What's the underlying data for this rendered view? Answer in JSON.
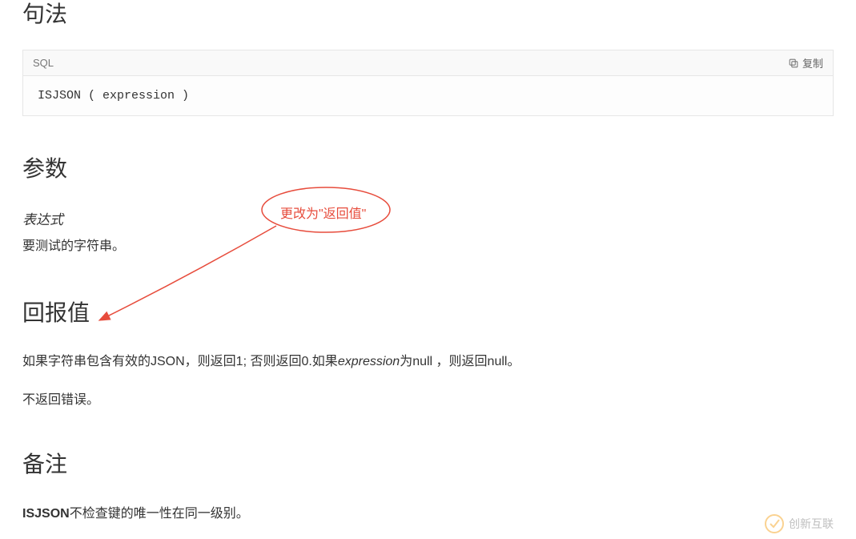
{
  "headings": {
    "syntax": "句法",
    "params": "参数",
    "return": "回报值",
    "remarks": "备注"
  },
  "code": {
    "lang_label": "SQL",
    "copy_label": "复制",
    "body": "ISJSON ( expression )"
  },
  "params": {
    "name": "表达式",
    "desc": "要测试的字符串。"
  },
  "return": {
    "p1_a": "如果字符串包含有效的JSON，则返回1; 否则返回0.如果",
    "p1_expr": "expression",
    "p1_b": "为null ，则返回null。",
    "p2": "不返回错误。"
  },
  "remarks": {
    "bold": "ISJSON",
    "rest": "不检查键的唯一性在同一级别。"
  },
  "annotation": {
    "text": "更改为\"返回值\""
  },
  "watermark": {
    "text": "创新互联"
  }
}
